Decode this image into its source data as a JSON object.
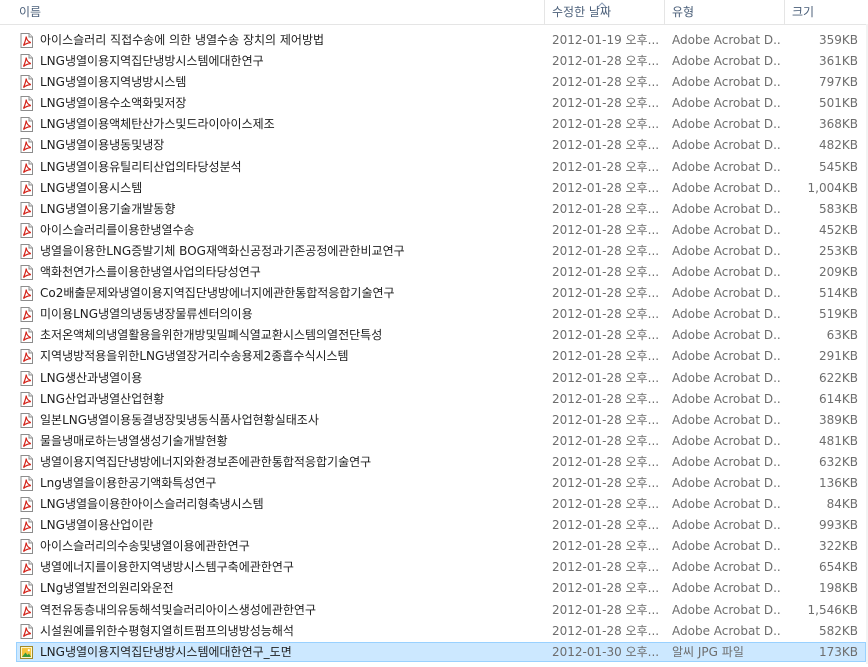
{
  "columns": {
    "name": "이름",
    "date": "수정한 날짜",
    "type": "유형",
    "size": "크기"
  },
  "files": [
    {
      "name": "아이스슬러리 직접수송에 의한 냉열수송 장치의 제어방법",
      "date": "2012-01-19 오후...",
      "type": "Adobe Acrobat D...",
      "size": "359KB",
      "icon": "pdf-file-icon"
    },
    {
      "name": "LNG냉열이용지역집단냉방시스템에대한연구",
      "date": "2012-01-28 오후...",
      "type": "Adobe Acrobat D...",
      "size": "361KB",
      "icon": "pdf-file-icon"
    },
    {
      "name": "LNG냉열이용지역냉방시스템",
      "date": "2012-01-28 오후...",
      "type": "Adobe Acrobat D...",
      "size": "797KB",
      "icon": "pdf-file-icon"
    },
    {
      "name": "LNG냉열이용수소액화및저장",
      "date": "2012-01-28 오후...",
      "type": "Adobe Acrobat D...",
      "size": "501KB",
      "icon": "pdf-file-icon"
    },
    {
      "name": "LNG냉열이용액체탄산가스및드라이아이스제조",
      "date": "2012-01-28 오후...",
      "type": "Adobe Acrobat D...",
      "size": "368KB",
      "icon": "pdf-file-icon"
    },
    {
      "name": "LNG냉열이용냉동및냉장",
      "date": "2012-01-28 오후...",
      "type": "Adobe Acrobat D...",
      "size": "482KB",
      "icon": "pdf-file-icon"
    },
    {
      "name": "LNG냉열이용유틸리티산업의타당성분석",
      "date": "2012-01-28 오후...",
      "type": "Adobe Acrobat D...",
      "size": "545KB",
      "icon": "pdf-file-icon"
    },
    {
      "name": "LNG냉열이용시스템",
      "date": "2012-01-28 오후...",
      "type": "Adobe Acrobat D...",
      "size": "1,004KB",
      "icon": "pdf-file-icon"
    },
    {
      "name": "LNG냉열이용기술개발동향",
      "date": "2012-01-28 오후...",
      "type": "Adobe Acrobat D...",
      "size": "583KB",
      "icon": "pdf-file-icon"
    },
    {
      "name": "아이스슬러리를이용한냉열수송",
      "date": "2012-01-28 오후...",
      "type": "Adobe Acrobat D...",
      "size": "452KB",
      "icon": "pdf-file-icon"
    },
    {
      "name": "냉열을이용한LNG증발기체 BOG재액화신공정과기존공정에관한비교연구",
      "date": "2012-01-28 오후...",
      "type": "Adobe Acrobat D...",
      "size": "253KB",
      "icon": "pdf-file-icon"
    },
    {
      "name": "액화천연가스를이용한냉열사업의타당성연구",
      "date": "2012-01-28 오후...",
      "type": "Adobe Acrobat D...",
      "size": "209KB",
      "icon": "pdf-file-icon"
    },
    {
      "name": "Co2배출문제와냉열이용지역집단냉방에너지에관한통합적응합기술연구",
      "date": "2012-01-28 오후...",
      "type": "Adobe Acrobat D...",
      "size": "514KB",
      "icon": "pdf-file-icon"
    },
    {
      "name": "미이용LNG냉열의냉동냉장물류센터의이용",
      "date": "2012-01-28 오후...",
      "type": "Adobe Acrobat D...",
      "size": "519KB",
      "icon": "pdf-file-icon"
    },
    {
      "name": "초저온액체의냉열활용을위한개방및밀폐식열교환시스템의열전단특성",
      "date": "2012-01-28 오후...",
      "type": "Adobe Acrobat D...",
      "size": "63KB",
      "icon": "pdf-file-icon"
    },
    {
      "name": "지역냉방적용을위한LNG냉열장거리수송용제2종흡수식시스템",
      "date": "2012-01-28 오후...",
      "type": "Adobe Acrobat D...",
      "size": "291KB",
      "icon": "pdf-file-icon"
    },
    {
      "name": "LNG생산과냉열이용",
      "date": "2012-01-28 오후...",
      "type": "Adobe Acrobat D...",
      "size": "622KB",
      "icon": "pdf-file-icon"
    },
    {
      "name": "LNG산업과냉열산업현황",
      "date": "2012-01-28 오후...",
      "type": "Adobe Acrobat D...",
      "size": "614KB",
      "icon": "pdf-file-icon"
    },
    {
      "name": "일본LNG냉열이용동결냉장및냉동식품사업현황실태조사",
      "date": "2012-01-28 오후...",
      "type": "Adobe Acrobat D...",
      "size": "389KB",
      "icon": "pdf-file-icon"
    },
    {
      "name": "물을냉매로하는냉열생성기술개발현황",
      "date": "2012-01-28 오후...",
      "type": "Adobe Acrobat D...",
      "size": "481KB",
      "icon": "pdf-file-icon"
    },
    {
      "name": "냉열이용지역집단냉방에너지와환경보존에관한통합적응합기술연구",
      "date": "2012-01-28 오후...",
      "type": "Adobe Acrobat D...",
      "size": "632KB",
      "icon": "pdf-file-icon"
    },
    {
      "name": "Lng냉열을이용한공기액화특성연구",
      "date": "2012-01-28 오후...",
      "type": "Adobe Acrobat D...",
      "size": "136KB",
      "icon": "pdf-file-icon"
    },
    {
      "name": "LNG냉열을이용한아이스슬러리형축냉시스템",
      "date": "2012-01-28 오후...",
      "type": "Adobe Acrobat D...",
      "size": "84KB",
      "icon": "pdf-file-icon"
    },
    {
      "name": "LNG냉열이용산업이란",
      "date": "2012-01-28 오후...",
      "type": "Adobe Acrobat D...",
      "size": "993KB",
      "icon": "pdf-file-icon"
    },
    {
      "name": "아이스슬러리의수송및냉열이용에관한연구",
      "date": "2012-01-28 오후...",
      "type": "Adobe Acrobat D...",
      "size": "322KB",
      "icon": "pdf-file-icon"
    },
    {
      "name": "냉열에너지를이용한지역냉방시스템구축에관한연구",
      "date": "2012-01-28 오후...",
      "type": "Adobe Acrobat D...",
      "size": "654KB",
      "icon": "pdf-file-icon"
    },
    {
      "name": "LNg냉열발전의원리와운전",
      "date": "2012-01-28 오후...",
      "type": "Adobe Acrobat D...",
      "size": "198KB",
      "icon": "pdf-file-icon"
    },
    {
      "name": "역전유동층내의유동해석및슬러리아이스생성에관한연구",
      "date": "2012-01-28 오후...",
      "type": "Adobe Acrobat D...",
      "size": "1,546KB",
      "icon": "pdf-file-icon"
    },
    {
      "name": "시설원예를위한수평형지열히트펌프의냉방성능해석",
      "date": "2012-01-28 오후...",
      "type": "Adobe Acrobat D...",
      "size": "582KB",
      "icon": "pdf-file-icon"
    },
    {
      "name": "LNG냉열이용지역집단냉방시스템에대한연구_도면",
      "date": "2012-01-30 오후...",
      "type": "알씨 JPG 파일",
      "size": "173KB",
      "icon": "jpg-file-icon",
      "selected": true
    }
  ]
}
